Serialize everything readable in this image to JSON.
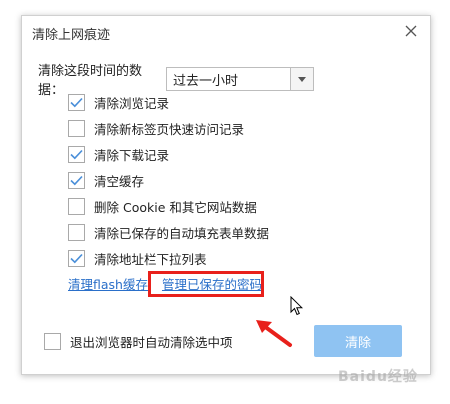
{
  "dialog": {
    "title": "清除上网痕迹"
  },
  "time_range": {
    "label": "清除这段时间的数据：",
    "selected": "过去一小时"
  },
  "options": [
    {
      "label": "清除浏览记录",
      "checked": true
    },
    {
      "label": "清除新标签页快速访问记录",
      "checked": false
    },
    {
      "label": "清除下载记录",
      "checked": true
    },
    {
      "label": "清空缓存",
      "checked": true
    },
    {
      "label": "删除 Cookie 和其它网站数据",
      "checked": false
    },
    {
      "label": "清除已保存的自动填充表单数据",
      "checked": false
    },
    {
      "label": "清除地址栏下拉列表",
      "checked": true
    }
  ],
  "links": {
    "flash": "清理flash缓存",
    "passwords": "管理已保存的密码"
  },
  "footer": {
    "auto_clear_label": "退出浏览器时自动清除选中项",
    "auto_clear_checked": false,
    "clear_button": "清除"
  },
  "watermark": "Baidu经验",
  "colors": {
    "accent": "#2a6fc9",
    "check": "#4a8fd9",
    "button": "#8fc3f2",
    "highlight": "#e8201b"
  }
}
